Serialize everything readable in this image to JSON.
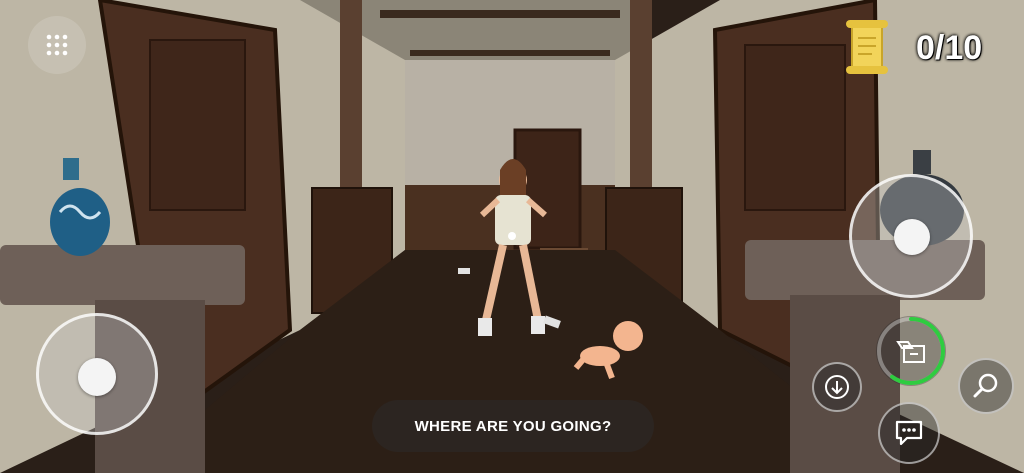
{
  "hud": {
    "note_counter": "0/10",
    "dialog_text": "WHERE ARE YOU GOING?"
  },
  "icons": {
    "menu": "grid-dots-icon",
    "notes": "scroll-icon",
    "hide": "hide-in-box-icon",
    "crouch": "arrow-down-icon",
    "search": "magnifier-icon",
    "chat": "speech-bubble-icon"
  },
  "colors": {
    "progress_ring": "#2ecc40",
    "scroll": "#f2d45a"
  },
  "hide_action_progress": 0.6
}
